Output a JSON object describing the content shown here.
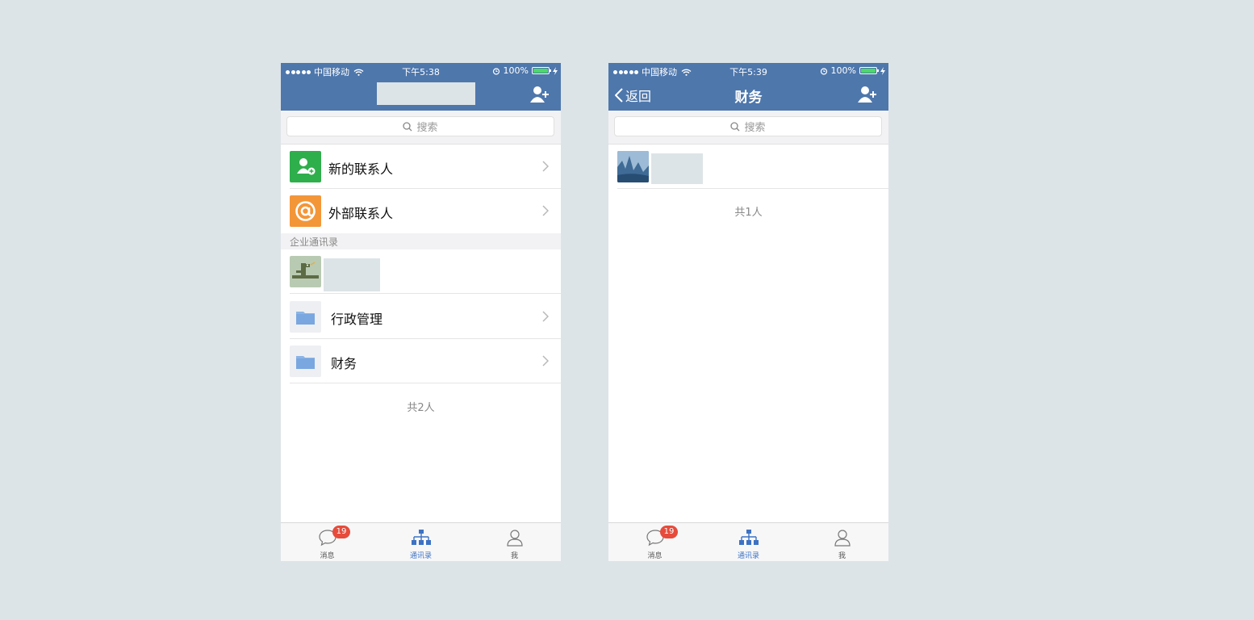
{
  "colors": {
    "nav_blue": "#4e77ac",
    "badge_red": "#e64b3b",
    "active_tab": "#3d72c4",
    "new_contact_green": "#2fae4c",
    "external_orange": "#f39638",
    "folder_blue": "#8cb4e6"
  },
  "left_screen": {
    "status": {
      "carrier": "中国移动",
      "time": "下午5:38",
      "battery": "100%"
    },
    "search": {
      "placeholder": "搜索"
    },
    "menu": [
      {
        "label": "新的联系人",
        "icon": "add-contact-icon"
      },
      {
        "label": "外部联系人",
        "icon": "at-icon"
      }
    ],
    "section_title": "企业通讯录",
    "departments": [
      {
        "label": "行政管理",
        "icon": "folder-icon"
      },
      {
        "label": "财务",
        "icon": "folder-icon"
      }
    ],
    "count_text": "共2人"
  },
  "right_screen": {
    "status": {
      "carrier": "中国移动",
      "time": "下午5:39",
      "battery": "100%"
    },
    "back_label": "返回",
    "title": "财务",
    "search": {
      "placeholder": "搜索"
    },
    "count_text": "共1人"
  },
  "tabs": [
    {
      "label": "消息",
      "icon": "chat-bubble-icon",
      "badge": "19"
    },
    {
      "label": "通讯录",
      "icon": "org-chart-icon",
      "active": true
    },
    {
      "label": "我",
      "icon": "person-icon"
    }
  ]
}
